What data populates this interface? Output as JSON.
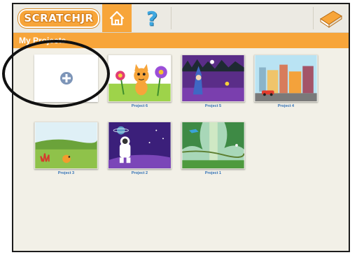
{
  "app": {
    "logo_text": "SCRATCHJR"
  },
  "nav": {
    "home_icon": "house-icon",
    "help_label": "?",
    "book_icon": "book-icon"
  },
  "section": {
    "title": "My Projects"
  },
  "new_project": {
    "icon": "plus-icon"
  },
  "projects": [
    {
      "label": "Project 6",
      "scene": "cat-flowers"
    },
    {
      "label": "Project 5",
      "scene": "wizard-night"
    },
    {
      "label": "Project 4",
      "scene": "city-street"
    },
    {
      "label": "Project 3",
      "scene": "farm-bird"
    },
    {
      "label": "Project 2",
      "scene": "astronaut-space"
    },
    {
      "label": "Project 1",
      "scene": "jungle"
    }
  ],
  "colors": {
    "accent": "#f7a53a",
    "caption": "#2f6fb5",
    "background": "#f2f0e7"
  }
}
